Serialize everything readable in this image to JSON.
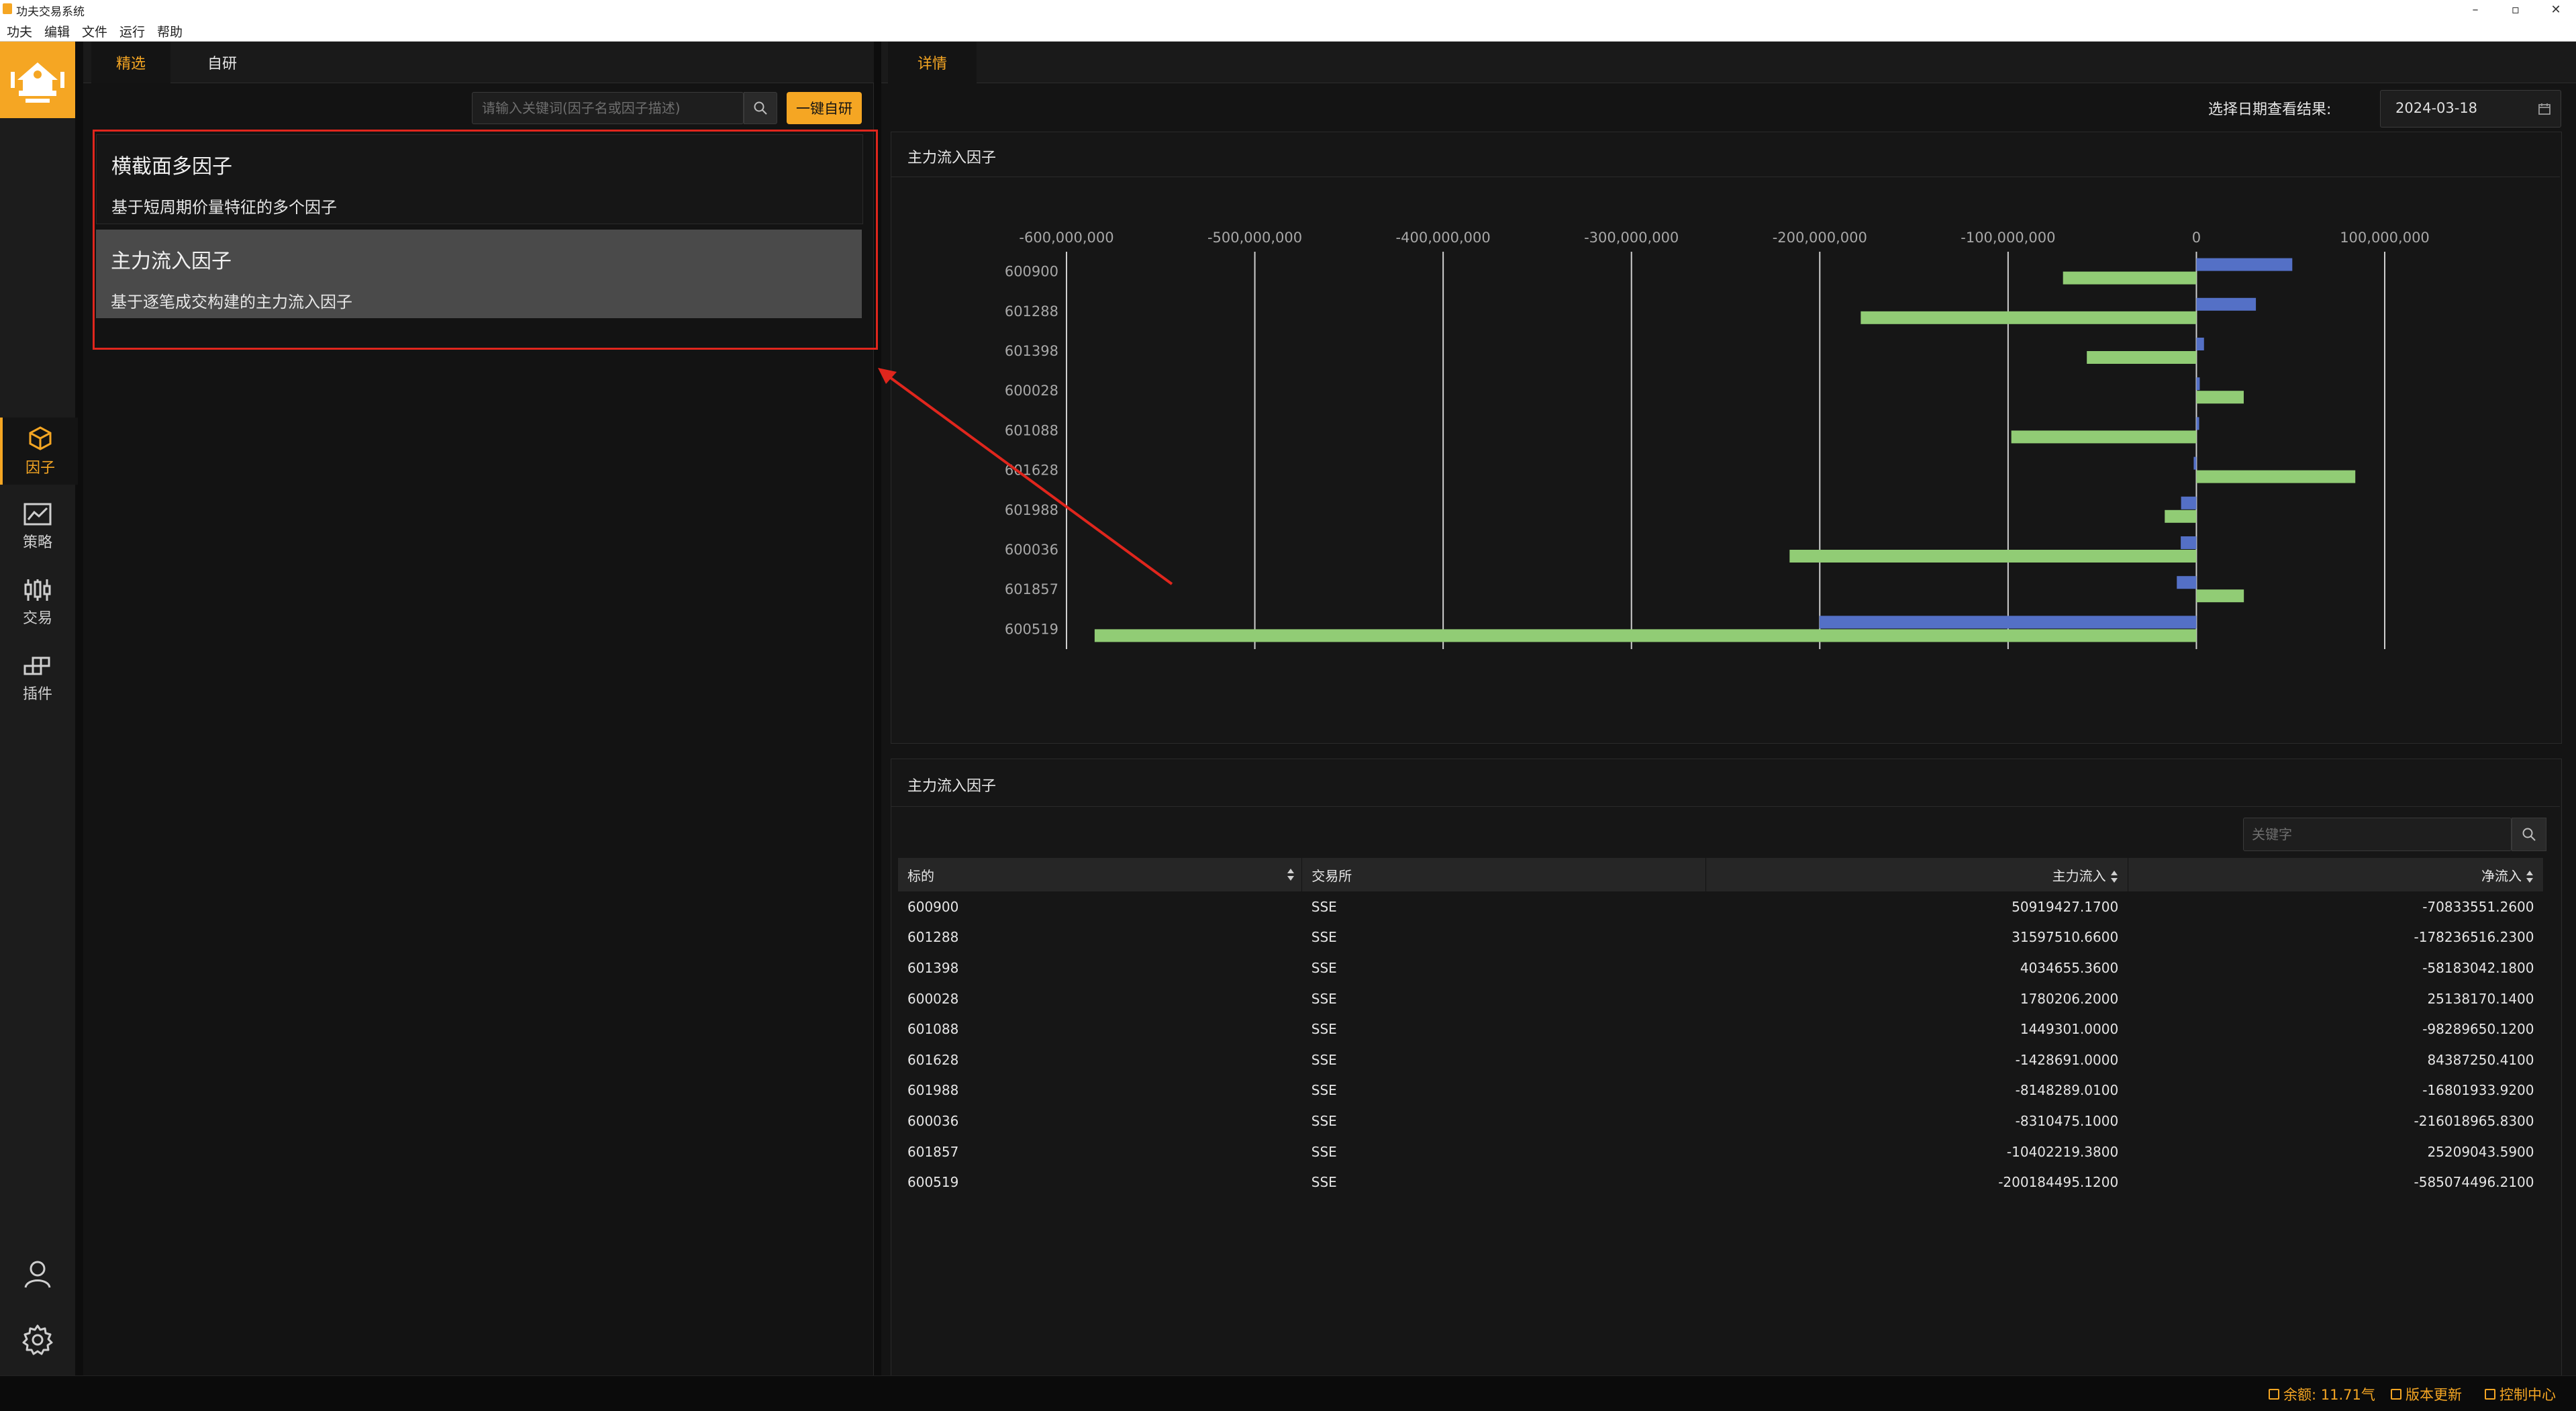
{
  "window": {
    "title": "功夫交易系统",
    "min": "–",
    "restore": "▫",
    "close": "✕"
  },
  "menu": [
    "功夫",
    "编辑",
    "文件",
    "运行",
    "帮助"
  ],
  "nav": {
    "items": [
      {
        "label": "因子",
        "icon": "cube-icon",
        "active": true
      },
      {
        "label": "策略",
        "icon": "line-chart-icon",
        "active": false
      },
      {
        "label": "交易",
        "icon": "candlestick-icon",
        "active": false
      },
      {
        "label": "插件",
        "icon": "plugin-blocks-icon",
        "active": false
      }
    ]
  },
  "left": {
    "tabs": [
      "精选",
      "自研"
    ],
    "search_placeholder": "请输入关键词(因子名或因子描述)",
    "quick_button": "一键自研",
    "factors": [
      {
        "name": "横截面多因子",
        "desc": "基于短周期价量特征的多个因子"
      },
      {
        "name": "主力流入因子",
        "desc": "基于逐笔成交构建的主力流入因子"
      }
    ]
  },
  "right": {
    "tab": "详情",
    "date_label": "选择日期查看结果:",
    "date_value": "2024-03-18",
    "chart_title": "主力流入因子",
    "table_title": "主力流入因子",
    "keyword_placeholder": "关键字",
    "columns": [
      "标的",
      "交易所",
      "主力流入",
      "净流入"
    ],
    "rows": [
      [
        "600900",
        "SSE",
        "50919427.1700",
        "-70833551.2600"
      ],
      [
        "601288",
        "SSE",
        "31597510.6600",
        "-178236516.2300"
      ],
      [
        "601398",
        "SSE",
        "4034655.3600",
        "-58183042.1800"
      ],
      [
        "600028",
        "SSE",
        "1780206.2000",
        "25138170.1400"
      ],
      [
        "601088",
        "SSE",
        "1449301.0000",
        "-98289650.1200"
      ],
      [
        "601628",
        "SSE",
        "-1428691.0000",
        "84387250.4100"
      ],
      [
        "601988",
        "SSE",
        "-8148289.0100",
        "-16801933.9200"
      ],
      [
        "600036",
        "SSE",
        "-8310475.1000",
        "-216018965.8300"
      ],
      [
        "601857",
        "SSE",
        "-10402219.3800",
        "25209043.5900"
      ],
      [
        "600519",
        "SSE",
        "-200184495.1200",
        "-585074496.2100"
      ]
    ]
  },
  "status": {
    "balance": "余额: 11.71气",
    "update": "版本更新",
    "control": "控制中心"
  },
  "colors": {
    "accent": "#f5a623",
    "series_main": "#5470c6",
    "series_net": "#91cc75",
    "highlight_box": "#e0261d"
  },
  "chart_data": {
    "type": "bar",
    "orientation": "horizontal",
    "categories": [
      "600900",
      "601288",
      "601398",
      "600028",
      "601088",
      "601628",
      "601988",
      "600036",
      "601857",
      "600519"
    ],
    "series": [
      {
        "values": [
          50919427.17,
          31597510.66,
          4034655.36,
          1780206.2,
          1449301.0,
          -1428691.0,
          -8148289.01,
          -8310475.1,
          -10402219.38,
          -200184495.12
        ]
      },
      {
        "values": [
          -70833551.26,
          -178236516.23,
          -58183042.18,
          25138170.14,
          -98289650.12,
          84387250.41,
          -16801933.92,
          -216018965.83,
          25209043.59,
          -585074496.21
        ]
      }
    ],
    "xlim": [
      -600000000,
      100000000
    ],
    "xticks": [
      -600000000,
      -500000000,
      -400000000,
      -300000000,
      -200000000,
      -100000000,
      0,
      100000000
    ],
    "xtick_labels": [
      "-600,000,000",
      "-500,000,000",
      "-400,000,000",
      "-300,000,000",
      "-200,000,000",
      "-100,000,000",
      "0",
      "100,000,000"
    ],
    "grid": true,
    "legend": "none"
  }
}
